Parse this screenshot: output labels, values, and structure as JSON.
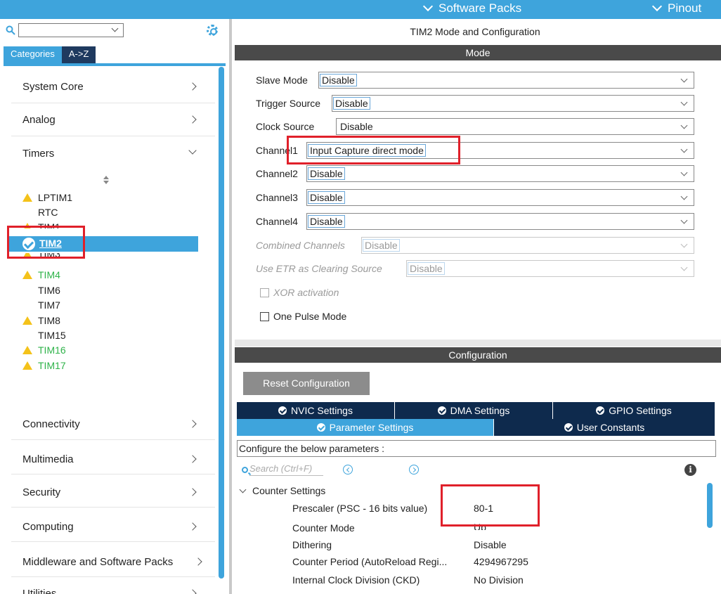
{
  "topbar": {
    "software_packs": "Software Packs",
    "pinout": "Pinout"
  },
  "left": {
    "tabs": {
      "categories": "Categories",
      "az": "A->Z"
    },
    "categories": {
      "system_core": "System Core",
      "analog": "Analog",
      "timers": "Timers",
      "connectivity": "Connectivity",
      "multimedia": "Multimedia",
      "security": "Security",
      "computing": "Computing",
      "middleware": "Middleware and Software Packs",
      "utilities": "Utilities"
    },
    "timers": [
      {
        "name": "LPTIM1",
        "status": "warning",
        "color": "normal"
      },
      {
        "name": "RTC",
        "status": "none",
        "color": "normal"
      },
      {
        "name": "TIM1",
        "status": "warning",
        "color": "normal"
      },
      {
        "name": "TIM2",
        "status": "ok",
        "color": "selected"
      },
      {
        "name": "TIM3",
        "status": "warning",
        "color": "normal"
      },
      {
        "name": "TIM4",
        "status": "warning",
        "color": "green"
      },
      {
        "name": "TIM6",
        "status": "none",
        "color": "normal"
      },
      {
        "name": "TIM7",
        "status": "none",
        "color": "normal"
      },
      {
        "name": "TIM8",
        "status": "warning",
        "color": "normal"
      },
      {
        "name": "TIM15",
        "status": "none",
        "color": "normal"
      },
      {
        "name": "TIM16",
        "status": "warning",
        "color": "green"
      },
      {
        "name": "TIM17",
        "status": "warning",
        "color": "green"
      }
    ]
  },
  "right": {
    "title": "TIM2 Mode and Configuration",
    "mode_bar": "Mode",
    "mode": {
      "slave_mode": {
        "label": "Slave Mode",
        "value": "Disable"
      },
      "trigger_source": {
        "label": "Trigger Source",
        "value": "Disable"
      },
      "clock_source": {
        "label": "Clock Source",
        "value": "Disable"
      },
      "channel1": {
        "label": "Channel1",
        "value": "Input Capture direct mode"
      },
      "channel2": {
        "label": "Channel2",
        "value": "Disable"
      },
      "channel3": {
        "label": "Channel3",
        "value": "Disable"
      },
      "channel4": {
        "label": "Channel4",
        "value": "Disable"
      },
      "combined": {
        "label": "Combined Channels",
        "value": "Disable"
      },
      "etr": {
        "label": "Use ETR as Clearing Source",
        "value": "Disable"
      },
      "xor": "XOR activation",
      "one_pulse": "One Pulse Mode"
    },
    "config_bar": "Configuration",
    "reset_button": "Reset Configuration",
    "tabs": {
      "nvic": "NVIC Settings",
      "dma": "DMA Settings",
      "gpio": "GPIO Settings",
      "parameter": "Parameter Settings",
      "user_constants": "User Constants"
    },
    "configure_text": "Configure the below parameters :",
    "search_placeholder": "Search (Ctrl+F)",
    "counter_settings": "Counter Settings",
    "params": [
      {
        "name": "Prescaler (PSC - 16 bits value)",
        "value": "80-1"
      },
      {
        "name": "Counter Mode",
        "value": "Up"
      },
      {
        "name": "Dithering",
        "value": "Disable"
      },
      {
        "name": "Counter Period (AutoReload Regi...",
        "value": "4294967295"
      },
      {
        "name": "Internal Clock Division (CKD)",
        "value": "No Division"
      }
    ]
  }
}
